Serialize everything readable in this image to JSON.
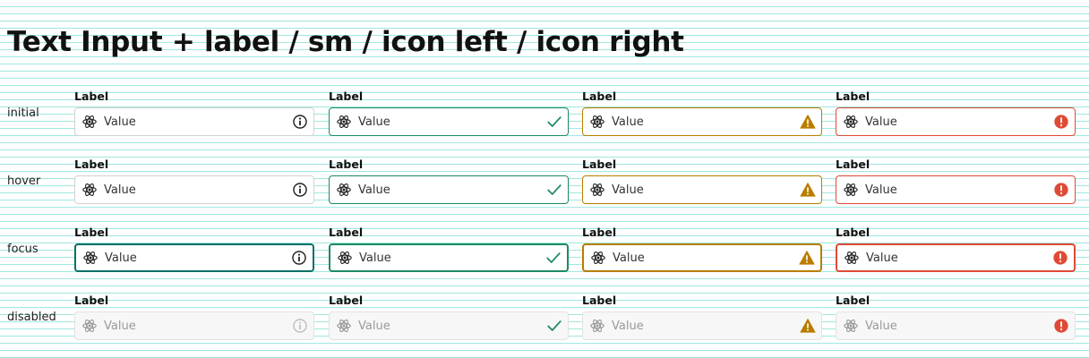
{
  "title": "Text Input + label / sm / icon left / icon right",
  "field_label": "Label",
  "field_value": "Value",
  "lead_icon": "atom-icon",
  "states": [
    {
      "key": "initial",
      "label": "initial"
    },
    {
      "key": "hover",
      "label": "hover"
    },
    {
      "key": "focus",
      "label": "focus"
    },
    {
      "key": "disabled",
      "label": "disabled"
    }
  ],
  "variants": [
    {
      "key": "default",
      "icon": "info-icon",
      "color": "#222222"
    },
    {
      "key": "success",
      "icon": "check-icon",
      "color": "#1e8a63"
    },
    {
      "key": "warning",
      "icon": "warning-icon",
      "color": "#b97d00"
    },
    {
      "key": "error",
      "icon": "error-icon",
      "color": "#e04a35"
    }
  ]
}
